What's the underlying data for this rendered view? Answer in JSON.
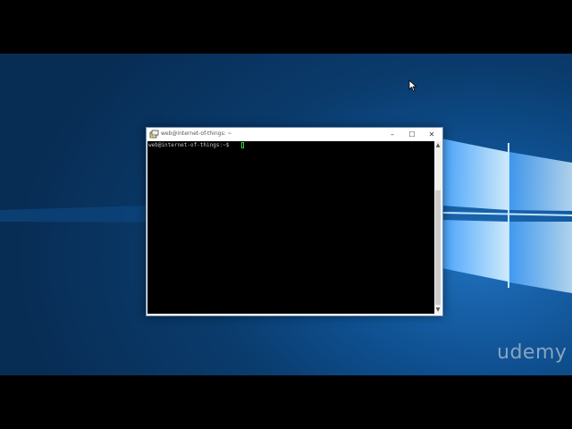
{
  "window": {
    "title": "web@internet-of-things: ~",
    "minimize_glyph": "–",
    "maximize_glyph": "☐",
    "close_glyph": "✕"
  },
  "terminal": {
    "prompt": "web@internet-of-things:~$"
  },
  "scrollbar": {
    "up_glyph": "▲",
    "down_glyph": "▼"
  },
  "watermark": {
    "text": "udemy"
  },
  "icons": {
    "app": "putty-icon",
    "pointer": "mouse-pointer-icon"
  },
  "colors": {
    "desktop": "#0a3b6c",
    "terminal_bg": "#000000",
    "prompt_text": "#c8c8c8",
    "cursor": "#2fd52f"
  }
}
